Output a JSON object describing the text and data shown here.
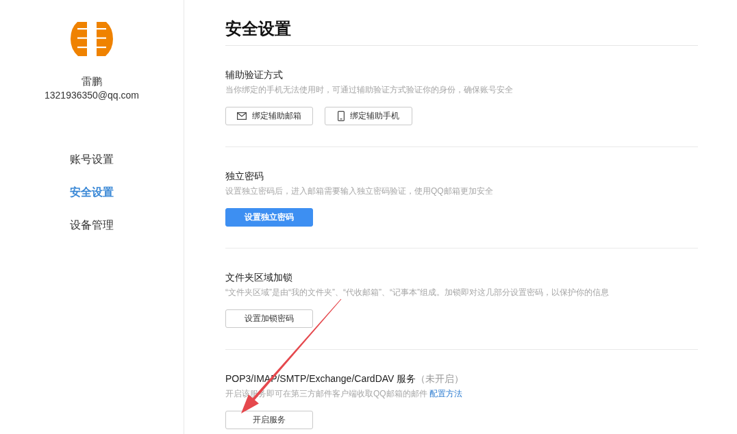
{
  "sidebar": {
    "user": {
      "name": "雷鹏",
      "email": "1321936350@qq.com"
    },
    "items": [
      {
        "label": "账号设置",
        "selected": false
      },
      {
        "label": "安全设置",
        "selected": true
      },
      {
        "label": "设备管理",
        "selected": false
      }
    ]
  },
  "page": {
    "title": "安全设置"
  },
  "sections": [
    {
      "title": "辅助验证方式",
      "description": "当你绑定的手机无法使用时，可通过辅助验证方式验证你的身份，确保账号安全",
      "buttons": [
        {
          "label": "绑定辅助邮箱",
          "kind": "envelope"
        },
        {
          "label": "绑定辅助手机",
          "kind": "phone"
        }
      ]
    },
    {
      "title": "独立密码",
      "description": "设置独立密码后，进入邮箱需要输入独立密码验证，使用QQ邮箱更加安全",
      "buttons": [
        {
          "label": "设置独立密码",
          "kind": "primary"
        }
      ]
    },
    {
      "title": "文件夹区域加锁",
      "description": "“文件夹区域”是由“我的文件夹”、“代收邮箱”、“记事本”组成。加锁即对这几部分设置密码，以保护你的信息",
      "buttons": [
        {
          "label": "设置加锁密码",
          "kind": "outline"
        }
      ]
    },
    {
      "title": "POP3/IMAP/SMTP/Exchange/CardDAV 服务",
      "status": "（未开启）",
      "description": "开启该服务即可在第三方邮件客户端收取QQ邮箱的邮件",
      "link": "配置方法",
      "buttons": [
        {
          "label": "开启服务",
          "kind": "outline"
        }
      ]
    }
  ]
}
